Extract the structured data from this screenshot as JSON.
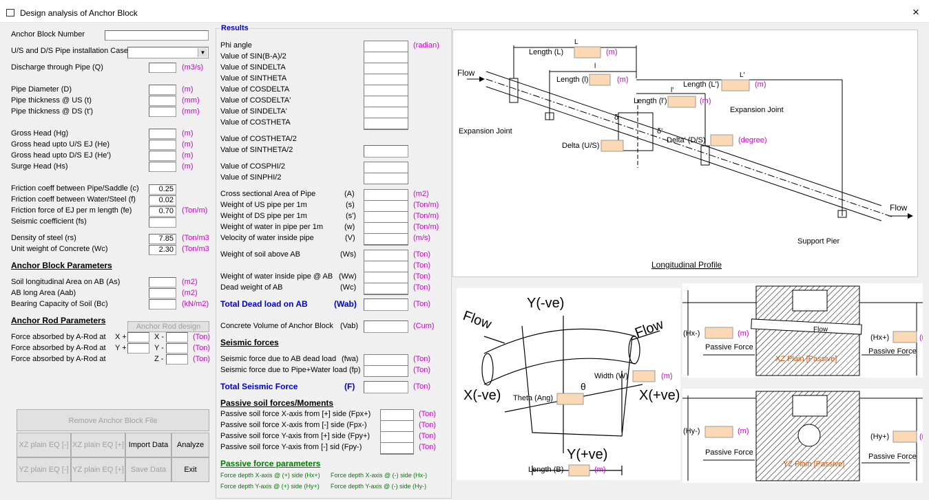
{
  "window": {
    "title": "Design analysis of Anchor Block",
    "close": "×"
  },
  "left": {
    "anchor_block_number": "Anchor Block Number",
    "pipe_case": "U/S and D/S Pipe installation Case",
    "discharge": "Discharge through Pipe (Q)",
    "discharge_unit": "(m3/s)",
    "pipe_diameter": "Pipe Diameter (D)",
    "pipe_diameter_unit": "(m)",
    "thk_us": "Pipe thickness @ US (t)",
    "thk_us_unit": "(mm)",
    "thk_ds": "Pipe thickness @ DS (t')",
    "thk_ds_unit": "(mm)",
    "gross_head": "Gross Head (Hg)",
    "gross_head_unit": "(m)",
    "gross_us": "Gross head upto U/S EJ (He)",
    "gross_us_unit": "(m)",
    "gross_ds": "Gross head upto D/S EJ (He')",
    "gross_ds_unit": "(m)",
    "surge": "Surge Head (Hs)",
    "surge_unit": "(m)",
    "fric_pipe": "Friction coeff between Pipe/Saddle (c)",
    "fric_pipe_val": "0.25",
    "fric_water": "Friction coeff between Water/Steel (f)",
    "fric_water_val": "0.02",
    "fric_ej": "Friction force of EJ per m length (fe)",
    "fric_ej_val": "0.70",
    "fric_ej_unit": "(Ton/m)",
    "seismic": "Seismic coefficient (fs)",
    "density": "Density of steel (rs)",
    "density_val": "7.85",
    "density_unit": "(Ton/m3",
    "unit_wt": "Unit weight of Concrete (Wc)",
    "unit_wt_val": "2.30",
    "unit_wt_unit": "(Ton/m3",
    "ab_params": "Anchor Block Parameters",
    "soil_area": "Soil longitudinal Area on AB (As)",
    "soil_area_unit": "(m2)",
    "ab_area": "AB long Area (Aab)",
    "ab_area_unit": "(m2)",
    "bearing": "Bearing Capacity of Soil (Bc)",
    "bearing_unit": "(kN/m2)",
    "rod_params": "Anchor Rod Parameters",
    "rod_design": "Anchor Rod design",
    "rod1": "Force absorbed by A-Rod at",
    "rod2": "Force absorbed by A-Rod at",
    "rod3": "Force absorbed by A-Rod at",
    "xp": "X +",
    "xm": "X -",
    "yp": "Y +",
    "ym": "Y -",
    "zm": "Z -",
    "ton": "(Ton)",
    "remove": "Remove Anchor Block File",
    "xz_m": "XZ plain EQ [-]",
    "xz_p": "XZ plain EQ [+]",
    "import": "Import Data",
    "analyze": "Analyze",
    "yz_m": "YZ plain EQ [-]",
    "yz_p": "YZ plain EQ [+]",
    "save": "Save Data",
    "exit": "Exit"
  },
  "results": {
    "title": "Results",
    "phi": "Phi angle",
    "phi_unit": "(radian)",
    "rows1": [
      "Value of SIN(B-A)/2",
      "Value of SINDELTA",
      "Value of SINTHETA",
      "Value of COSDELTA",
      "Value of COSDELTA'",
      "Value of SINDELTA'",
      "Value of COSTHETA"
    ],
    "costheta2": "Value of COSTHETA/2",
    "sintheta2": "Value of SINTHETA/2",
    "cosphi2": "Value of COSPHI/2",
    "sinphi2": "Value of SINPHI/2",
    "area": "Cross sectional Area of Pipe",
    "area_s": "(A)",
    "area_u": "(m2)",
    "wus": "Weight of US pipe per 1m",
    "wus_s": "(s)",
    "wus_u": "(Ton/m)",
    "wds": "Weight of DS pipe per 1m",
    "wds_s": "(s')",
    "wds_u": "(Ton/m)",
    "ww": "Weight of water in pipe per 1m",
    "ww_s": "(w)",
    "ww_u": "(Ton/m)",
    "vel": "Velocity of water inside pipe",
    "vel_s": "(V)",
    "vel_u": "(m/s)",
    "soil": "Weight of soil above AB",
    "soil_s": "(Ws)",
    "soil_u": "(Ton)",
    "soil_u2": "(Ton)",
    "wab": "Weight of water inside pipe @ AB",
    "wab_s": "(Ww)",
    "wab_u": "(Ton)",
    "dead": "Dead weight of AB",
    "dead_s": "(Wc)",
    "dead_u": "(Ton)",
    "tdl": "Total Dead load on AB",
    "tdl_s": "(Wab)",
    "tdl_u": "(Ton)",
    "cv": "Concrete Volume of Anchor Block",
    "cv_s": "(Vab)",
    "cv_u": "(Cum)",
    "seis_hdr": "Seismic forces",
    "sf1": "Seismic force due to AB dead load",
    "sf1_s": "(fwa)",
    "sf1_u": "(Ton)",
    "sf2": "Seismic force due to Pipe+Water load (fp)",
    "sf2_u": "(Ton)",
    "tsf": "Total Seismic Force",
    "tsf_s": "(F)",
    "tsf_u": "(Ton)",
    "pas_hdr": "Passive soil forces/Moments",
    "p1": "Passive soil force X-axis from [+] side  (Fpx+)",
    "p2": "Passive soil force X-axis from  [-] side  (Fpx-)",
    "p3": "Passive soil force Y-axis from [+] side  (Fpy+)",
    "p4": "Passive soil force Y-axis from [-] sid    (Fpy-)",
    "pf_hdr": "Passive force parameters",
    "g1": "Force depth X-axis @ (+) side    (Hx+)",
    "g2": "Force depth X-axis @ (-) side    (Hx-)",
    "g3": "Force depth Y-axis @ (+) side    (Hy+)",
    "g4": "Force depth Y-axis @ (-) side    (Hy-)"
  },
  "profile": {
    "flow": "Flow",
    "flow2": "Flow",
    "len_L": "Length (L)",
    "len_l": "Length (l)",
    "len_Lp": "Length (L')",
    "len_lp": "Length (l')",
    "m": "(m)",
    "ej1": "Expansion Joint",
    "ej2": "Expansion Joint",
    "delta_us": "Delta (U/S)",
    "delta_ds": "Delta' (D/S)",
    "deg": "(degree)",
    "support": "Support Pier",
    "caption": "Longitudinal Profile",
    "L": "L",
    "l": "l",
    "Lp": "L'",
    "lp": "l'",
    "d": "δ",
    "dp": "δ'"
  },
  "section": {
    "yneg": "Y(-ve)",
    "ypos": "Y(+ve)",
    "xneg": "X(-ve)",
    "xpos": "X(+ve)",
    "flow1": "Flow",
    "flow2": "Flow",
    "width": "Width (W)",
    "theta": "Theta (Ang)",
    "lenB": "Length (B)",
    "m": "(m)",
    "theta_sym": "θ"
  },
  "xz": {
    "hxm": "(Hx-)",
    "hxp": "(Hx+)",
    "m": "(m)",
    "pf1": "Passive Force",
    "pf2": "Passive Force",
    "flow": "Flow",
    "plain": "XZ Plain [Passive]"
  },
  "yz": {
    "hym": "(Hy-)",
    "hyp": "(Hy+)",
    "m": "(m)",
    "pf1": "Passive Force",
    "pf2": "Passive Force",
    "plain": "YZ Plain [Passive]"
  }
}
